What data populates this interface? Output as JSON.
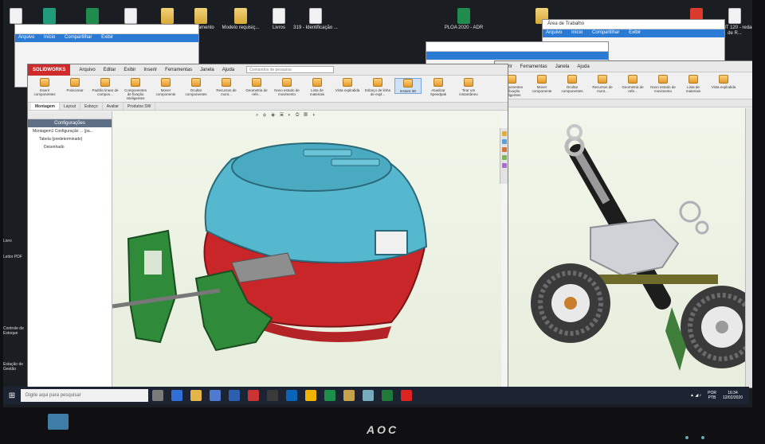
{
  "desktop": {
    "icons": [
      {
        "label": "",
        "type": "doc"
      },
      {
        "label": "",
        "type": "app"
      },
      {
        "label": "",
        "type": "green"
      },
      {
        "label": "",
        "type": "doc"
      },
      {
        "label": "",
        "type": "folder"
      },
      {
        "label": "Treinamento",
        "type": "folder"
      },
      {
        "label": "Modelo requisiç...",
        "type": "folder"
      },
      {
        "label": "Livros",
        "type": "doc"
      },
      {
        "label": "319 - Identificação ...",
        "type": "doc"
      },
      {
        "label": "PLOA 2020 - ADR",
        "type": "green"
      },
      {
        "label": "",
        "type": "folder"
      },
      {
        "label": "",
        "type": "red"
      },
      {
        "label": "nota MIT 120 - redação de R...",
        "type": "doc"
      }
    ],
    "left_labels": [
      "Livro",
      "Leitor PDF",
      "Controle de Estoque",
      "Estação de Gestão"
    ]
  },
  "explorer_windows": [
    {
      "title": "",
      "ribbon": [
        "Arquivo",
        "Início",
        "Compartilhar",
        "Exibir"
      ]
    },
    {
      "title": "Área de Trabalho",
      "ribbon": [
        "Arquivo",
        "Início",
        "Compartilhar",
        "Exibir"
      ]
    }
  ],
  "solidworks_left": {
    "logo": "SOLIDWORKS",
    "menus": [
      "Arquivo",
      "Editar",
      "Exibir",
      "Inserir",
      "Ferramentas",
      "Janela",
      "Ajuda"
    ],
    "search_placeholder": "Comandos de pesquisa",
    "commands": [
      "Inserir componentes",
      "Posicionar",
      "Padrão linear de compon...",
      "Componentes de fixação inteligentes",
      "Mover componente",
      "Ocultar componentes",
      "Recursos de mont...",
      "Geometria de refe...",
      "Novo estudo de movimento",
      "Lista de materiais",
      "Vista explodida",
      "Esboço de linha de expl...",
      "Instant 3D",
      "Atualizar Speedpak",
      "Tirar um instantâneo"
    ],
    "tabs": [
      "Montagem",
      "Layout",
      "Esboço",
      "Avaliar",
      "Produtos SW"
    ],
    "tree_header": "Configurações",
    "tree_items": [
      "Montagem1 Configuração ... (pa...",
      "Tabela (predeterminado)",
      "Desenhado"
    ]
  },
  "solidworks_right": {
    "menus": [
      "Inserir",
      "Ferramentas",
      "Janela",
      "Ajuda"
    ],
    "commands": [
      "Componentes de fixação inteligentes",
      "Mover componente",
      "Ocultar componentes",
      "Recursos de mont...",
      "Geometria de refe...",
      "Novo estudo de movimento",
      "Lista de materiais",
      "Vista explodida"
    ]
  },
  "taskbar": {
    "search_placeholder": "Digite aqui para pesquisar",
    "lang_line1": "POR",
    "lang_line2": "PTB",
    "time": "16:34",
    "date": "12/02/2020"
  },
  "monitor": {
    "brand": "AOC"
  },
  "colors": {
    "turret_blue": "#55b8cf",
    "turret_red": "#c9262a",
    "mount_green": "#2f8a3a",
    "solidworks_red": "#cf2b2b",
    "taskbar": "#1c2433"
  }
}
